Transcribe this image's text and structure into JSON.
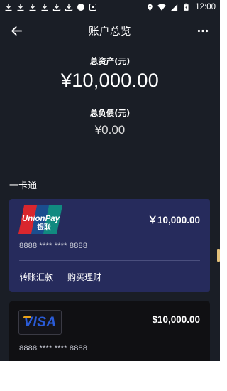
{
  "status_bar": {
    "time": "12:00",
    "left_icons": [
      "download-icon",
      "download-icon",
      "download-icon",
      "download-icon",
      "download-icon",
      "download-icon",
      "dot-icon",
      "app-icon"
    ],
    "right_icons": [
      "location-icon",
      "wifi-icon",
      "signal-icon",
      "battery-icon"
    ]
  },
  "app_bar": {
    "title": "账户总览",
    "back_icon": "back-arrow-icon",
    "more_icon": "more-icon"
  },
  "summary": {
    "assets_label": "总资产(元)",
    "assets_value": "¥10,000.00",
    "debt_label": "总负债(元)",
    "debt_value": "¥0.00"
  },
  "section": {
    "title": "一卡通"
  },
  "cards": [
    {
      "brand": "UnionPay",
      "logo_text": "UnionPay",
      "logo_text_cn": "银联",
      "amount": "￥10,000.00",
      "number": "8888 **** **** 8888",
      "actions": [
        "转账汇款",
        "购买理财"
      ],
      "color": "#262b5c"
    },
    {
      "brand": "VISA",
      "logo_text": "VISA",
      "amount": "$10,000.00",
      "number": "8888 **** **** 8888",
      "color": "#101013"
    }
  ],
  "colors": {
    "background": "#1a1e26",
    "unionpay_red": "#d9262e",
    "unionpay_blue": "#1b4e8f",
    "unionpay_green": "#118a80",
    "visa_blue": "#2a5bd7",
    "visa_gold": "#e8a21a"
  }
}
